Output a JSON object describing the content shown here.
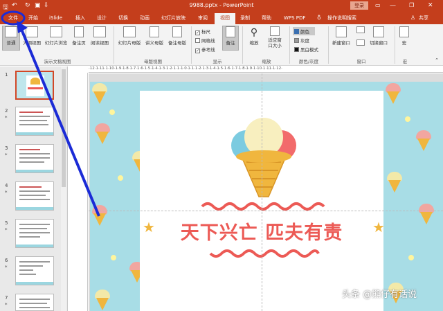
{
  "titlebar": {
    "title": "9988.pptx  -  PowerPoint",
    "login": "登录",
    "share": "共享"
  },
  "tabs": [
    {
      "label": "文件"
    },
    {
      "label": "开始"
    },
    {
      "label": "iSlide"
    },
    {
      "label": "插入"
    },
    {
      "label": "设计"
    },
    {
      "label": "切换"
    },
    {
      "label": "动画"
    },
    {
      "label": "幻灯片放映"
    },
    {
      "label": "审阅"
    },
    {
      "label": "视图"
    },
    {
      "label": "录制"
    },
    {
      "label": "帮助"
    },
    {
      "label": "WPS PDF"
    },
    {
      "label": "操作说明搜索"
    }
  ],
  "ribbon": {
    "views": [
      "普通",
      "大纲视图",
      "幻灯片浏览",
      "备注页",
      "阅读视图"
    ],
    "masters": [
      "幻灯片母版",
      "讲义母版",
      "备注母版"
    ],
    "show": [
      "标尺",
      "网格线",
      "参考线"
    ],
    "notes": "备注",
    "zoom": [
      "缩放",
      "适应窗口大小"
    ],
    "colors": [
      "颜色",
      "灰度",
      "黑白模式"
    ],
    "window": [
      "新建窗口",
      "切换窗口"
    ],
    "macro": "宏",
    "groups": [
      "演示文稿视图",
      "母版视图",
      "显示",
      "缩放",
      "颜色/灰度",
      "窗口",
      "宏"
    ]
  },
  "ruler_ticks": "·12·1·11·1·10·1·9·1·8·1·7·1·6·1·5·1·4·1·3·1·2·1·1·1·0·1·1·1·2·1·3·1·4·1·5·1·6·1·7·1·8·1·9·1·10·1·11·1·12·",
  "slides": [
    {
      "n": "1"
    },
    {
      "n": "2"
    },
    {
      "n": "3"
    },
    {
      "n": "4"
    },
    {
      "n": "5"
    },
    {
      "n": "6"
    },
    {
      "n": "7"
    }
  ],
  "slide_star": "*",
  "slide_text": "天下兴亡   匹夫有责",
  "watermark": "头条 @熊仔有话说",
  "colors": {
    "accent": "#c43e1c",
    "headline": "#ec5a55",
    "background": "#a8dde6",
    "annotation": "#1b2bd6"
  }
}
